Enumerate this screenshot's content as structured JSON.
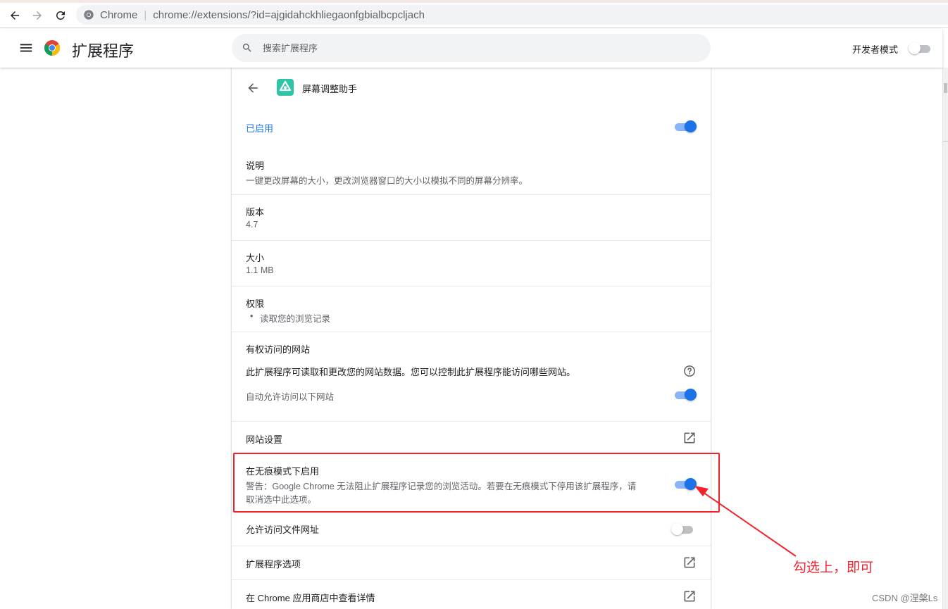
{
  "browser": {
    "site_label": "Chrome",
    "url": "chrome://extensions/?id=ajgidahckhliegaonfgbialbcpcljach"
  },
  "header": {
    "title": "扩展程序",
    "search_placeholder": "搜索扩展程序",
    "dev_mode_label": "开发者模式",
    "dev_mode_on": false
  },
  "detail": {
    "name": "屏幕调整助手",
    "enabled_label": "已启用",
    "enabled": true,
    "description_label": "说明",
    "description": "一键更改屏幕的大小，更改浏览器窗口的大小以模拟不同的屏幕分辨率。",
    "version_label": "版本",
    "version": "4.7",
    "size_label": "大小",
    "size": "1.1 MB",
    "permissions_label": "权限",
    "permissions": [
      "读取您的浏览记录"
    ],
    "site_access_label": "有权访问的网站",
    "site_access_desc": "此扩展程序可读取和更改您的网站数据。您可以控制此扩展程序能访问哪些网站。",
    "auto_allow_label": "自动允许访问以下网站",
    "auto_allow": true,
    "site_settings_label": "网站设置",
    "incognito_label": "在无痕模式下启用",
    "incognito_warning_line1": "警告：Google Chrome 无法阻止扩展程序记录您的浏览活动。若要在无痕模式下停用该扩展程序，请",
    "incognito_warning_line2": "取消选中此选项。",
    "incognito": true,
    "file_urls_label": "允许访问文件网址",
    "file_urls": false,
    "options_label": "扩展程序选项",
    "store_label": "在 Chrome 应用商店中查看详情"
  },
  "annotation": {
    "text": "勾选上，即可",
    "color": "#f5222d"
  },
  "watermark": "CSDN @涅槃Ls",
  "colors": {
    "accent": "#1a73e8",
    "toggle_track_on": "#8ab4f8",
    "ext_icon_bg": "#2ec4a5"
  }
}
